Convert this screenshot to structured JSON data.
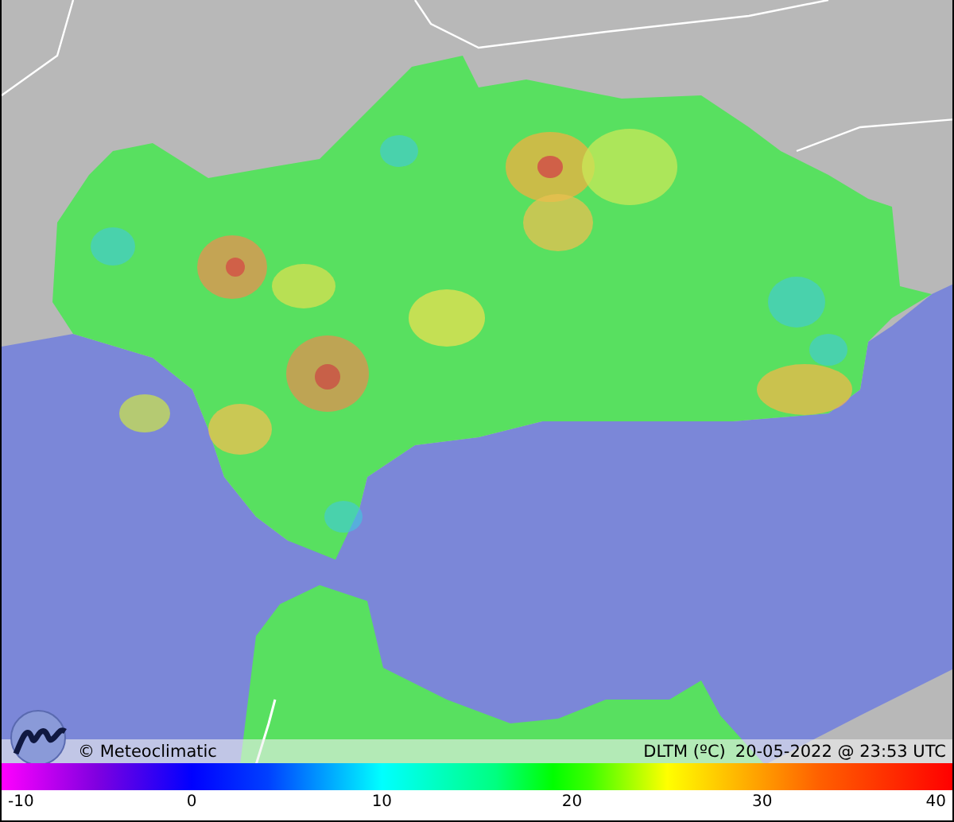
{
  "footer": {
    "credit": "© Meteoclimatic",
    "variable": "DLTM (ºC)",
    "timestamp": "20-05-2022 @ 23:53 UTC"
  },
  "scale": {
    "ticks": [
      "-10",
      "0",
      "10",
      "20",
      "30",
      "40"
    ]
  }
}
